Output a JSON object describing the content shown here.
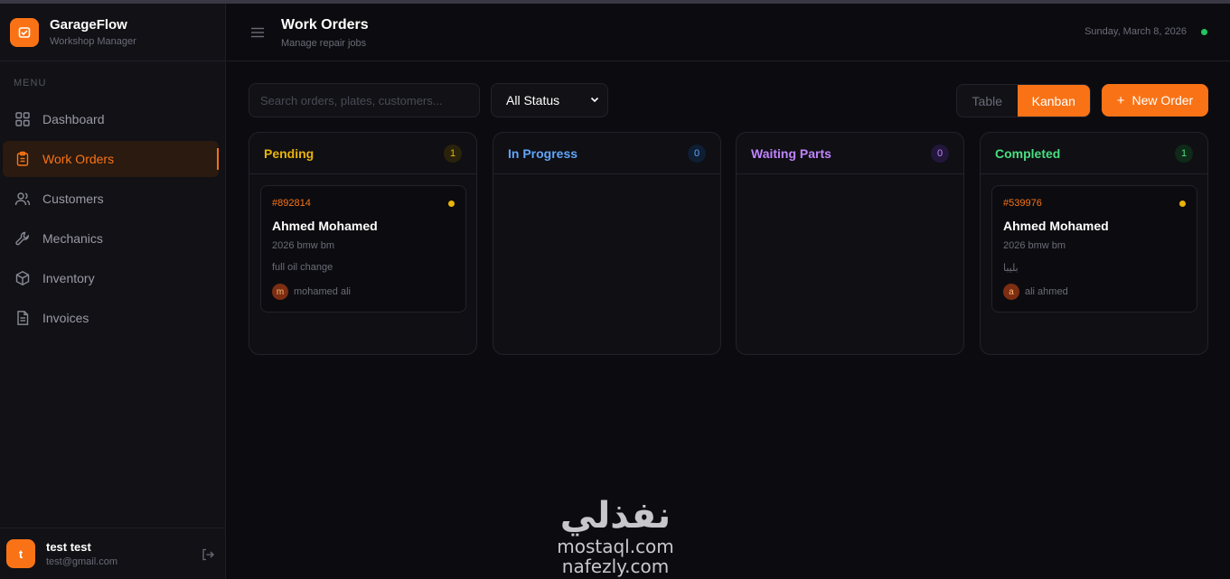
{
  "app": {
    "name": "GarageFlow",
    "subtitle": "Workshop Manager",
    "accent": "#f97316"
  },
  "sidebar": {
    "menu_label": "MENU",
    "items": [
      {
        "label": "Dashboard",
        "icon": "grid-icon",
        "active": false
      },
      {
        "label": "Work Orders",
        "icon": "clipboard-icon",
        "active": true
      },
      {
        "label": "Customers",
        "icon": "users-icon",
        "active": false
      },
      {
        "label": "Mechanics",
        "icon": "wrench-icon",
        "active": false
      },
      {
        "label": "Inventory",
        "icon": "box-icon",
        "active": false
      },
      {
        "label": "Invoices",
        "icon": "file-icon",
        "active": false
      }
    ],
    "user": {
      "initial": "t",
      "name": "test test",
      "email": "test@gmail.com"
    }
  },
  "header": {
    "title": "Work Orders",
    "subtitle": "Manage repair jobs",
    "date": "Sunday, March 8, 2026",
    "status_color": "#22c55e"
  },
  "toolbar": {
    "search_placeholder": "Search orders, plates, customers...",
    "status_filter": "All Status",
    "view_table": "Table",
    "view_kanban": "Kanban",
    "active_view": "Kanban",
    "new_order": "New Order"
  },
  "columns": [
    {
      "title": "Pending",
      "count": "1",
      "color": "#eab308",
      "cards": [
        {
          "id": "#892814",
          "customer": "Ahmed Mohamed",
          "car": "2026 bmw bm",
          "description": "full oil change",
          "mechanic_initial": "m",
          "mechanic": "mohamed ali"
        }
      ]
    },
    {
      "title": "In Progress",
      "count": "0",
      "color": "#60a5fa",
      "cards": []
    },
    {
      "title": "Waiting Parts",
      "count": "0",
      "color": "#c084fc",
      "cards": []
    },
    {
      "title": "Completed",
      "count": "1",
      "color": "#4ade80",
      "cards": [
        {
          "id": "#539976",
          "customer": "Ahmed Mohamed",
          "car": "2026 bmw bm",
          "description": "بليبا",
          "mechanic_initial": "a",
          "mechanic": "ali ahmed"
        }
      ]
    }
  ],
  "watermark": {
    "arabic": "نفذلي",
    "line1": "mostaql.com",
    "line2": "nafezly.com"
  }
}
